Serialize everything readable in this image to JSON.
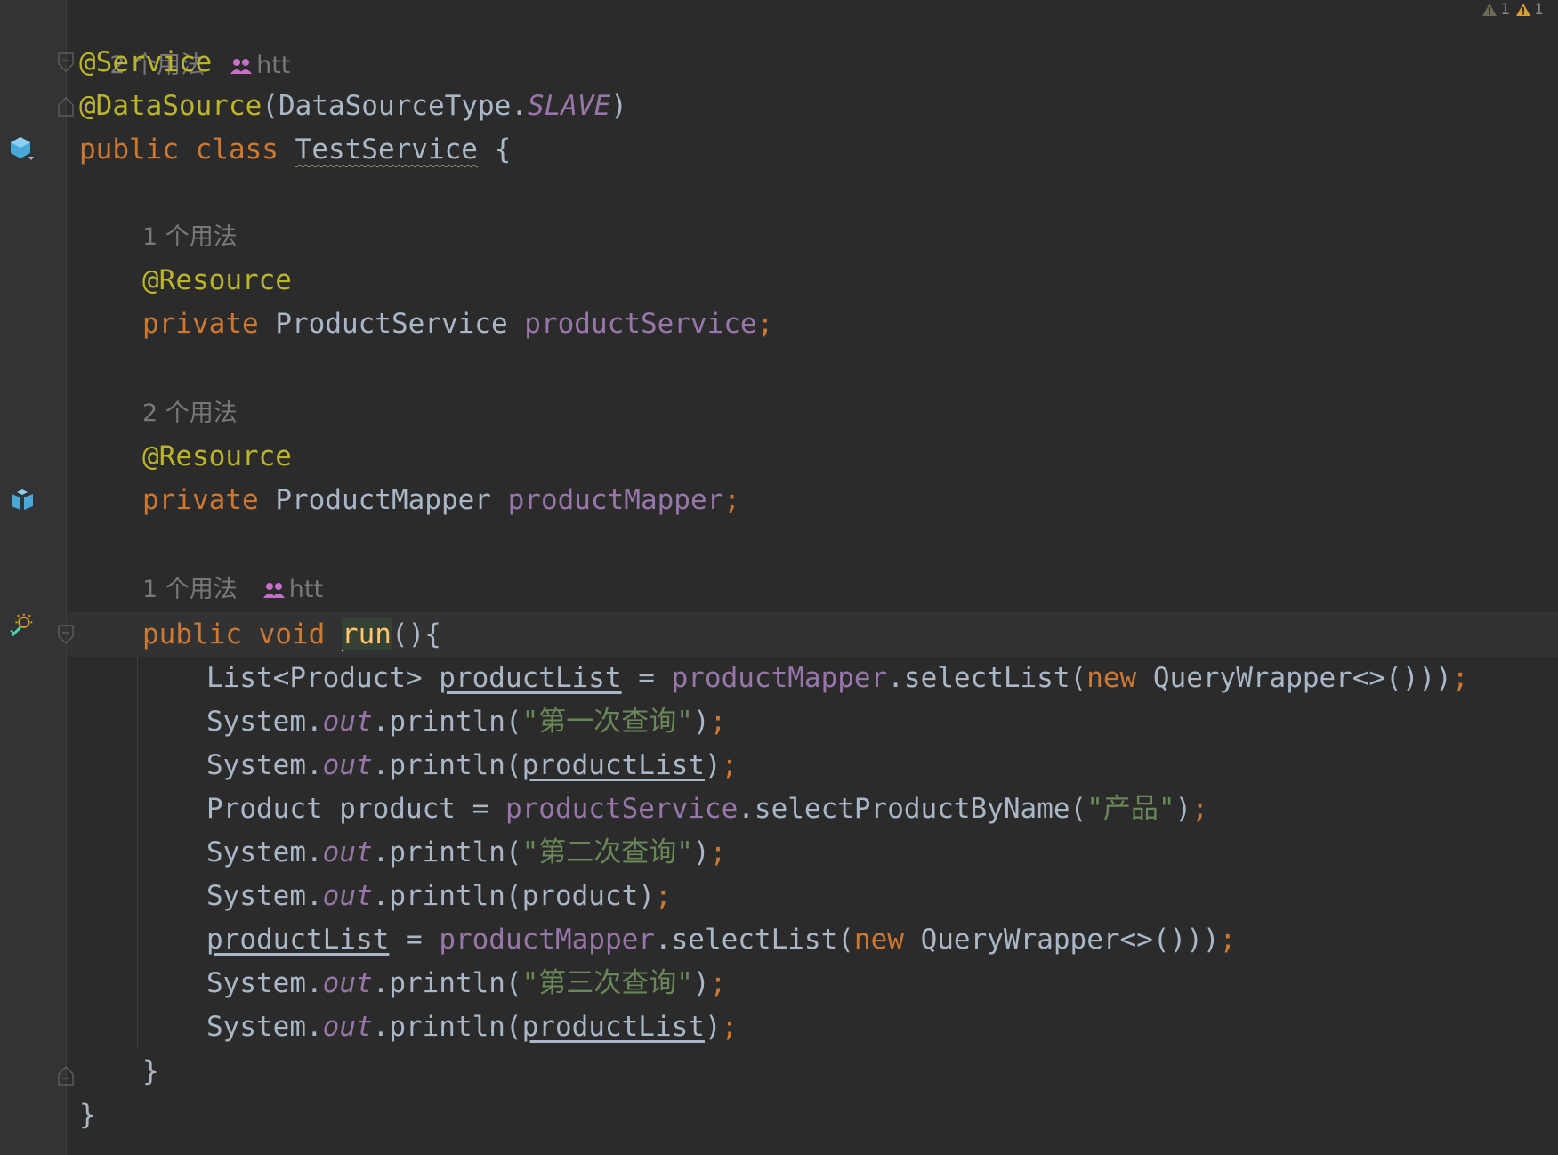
{
  "status": {
    "weak_warning_count": "1",
    "warning_count": "1"
  },
  "hints": {
    "class_usages": "2 个用法",
    "class_author": "htt",
    "field1_usages": "1 个用法",
    "field2_usages": "2 个用法",
    "method_usages": "1 个用法",
    "method_author": "htt"
  },
  "code": {
    "service_annotation": "@Service",
    "datasource_annotation": "@DataSource",
    "datasource_args_open": "(DataSourceType.",
    "datasource_const": "SLAVE",
    "datasource_args_close": ")",
    "kw_public": "public",
    "kw_class": "class",
    "class_name": "TestService",
    "brace_open": " {",
    "resource_annotation": "@Resource",
    "kw_private": "private",
    "type_product_service": "ProductService",
    "field_product_service": "productService",
    "type_product_mapper": "ProductMapper",
    "field_product_mapper": "productMapper",
    "semicolon": ";",
    "kw_void": "void",
    "method_name": "run",
    "method_sig_rest": "(){",
    "line1_type": "List<Product> ",
    "var_product_list": "productList",
    "assign": " = ",
    "call_select_list": ".selectList(",
    "kw_new": "new",
    "query_wrapper": " QueryWrapper<>())",
    "system": "System.",
    "out": "out",
    "println_open": ".println(",
    "str_first": "\"第一次查询\"",
    "str_second": "\"第二次查询\"",
    "str_third": "\"第三次查询\"",
    "close_paren": ")",
    "product_decl": "Product product = ",
    "call_select_by_name": ".selectProductByName(",
    "str_product": "\"产品\"",
    "product_var": "product",
    "method_close": "}",
    "class_close": "}"
  },
  "colors": {
    "background": "#2b2b2b",
    "gutter": "#313335",
    "keyword": "#cc7832",
    "annotation": "#bbb529",
    "field": "#9876aa",
    "string": "#6a8759",
    "plain": "#a9b7c6",
    "method_decl": "#ffc66d",
    "hint": "#787878",
    "author_icon": "#c770c7",
    "gutter_icon": "#4aa8d8"
  }
}
